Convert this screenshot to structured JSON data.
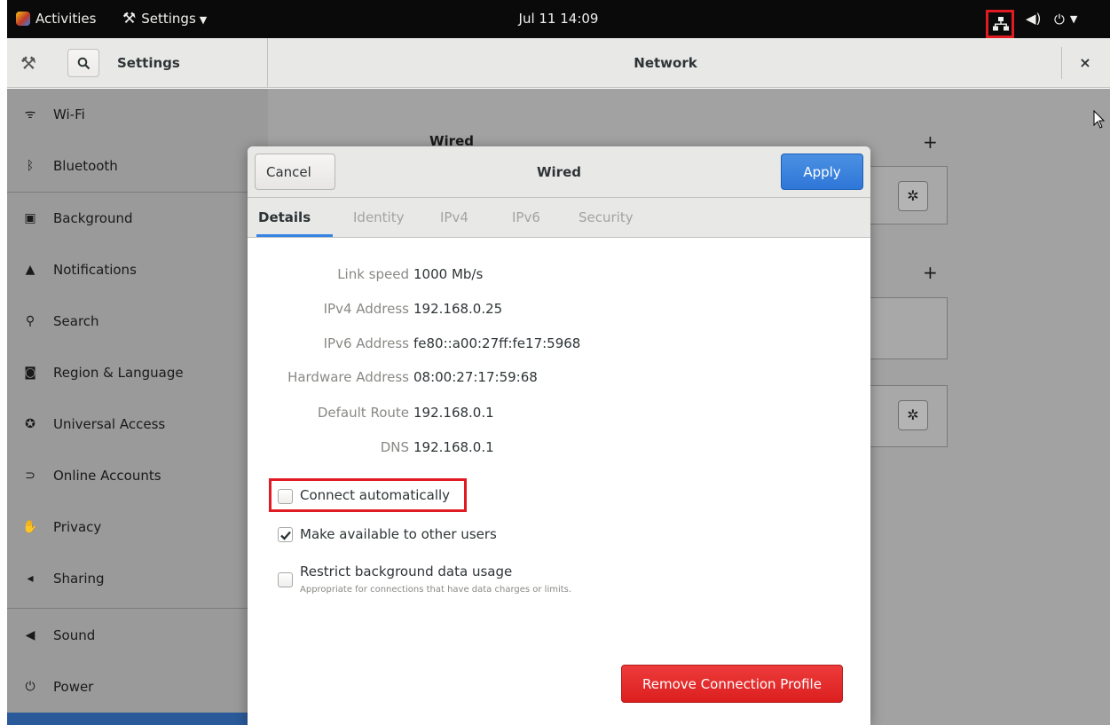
{
  "topbar": {
    "activities": "Activities",
    "app_menu": "Settings",
    "clock": "Jul 11  14:09"
  },
  "header": {
    "sidebar_title": "Settings",
    "title": "Network",
    "close_glyph": "×"
  },
  "sidebar": {
    "items": [
      {
        "label": "Wi-Fi",
        "icon": "wifi-icon"
      },
      {
        "label": "Bluetooth",
        "icon": "bluetooth-icon"
      },
      {
        "label": "Background",
        "icon": "background-icon"
      },
      {
        "label": "Notifications",
        "icon": "bell-icon"
      },
      {
        "label": "Search",
        "icon": "search-icon"
      },
      {
        "label": "Region & Language",
        "icon": "region-icon"
      },
      {
        "label": "Universal Access",
        "icon": "accessibility-icon"
      },
      {
        "label": "Online Accounts",
        "icon": "online-accounts-icon"
      },
      {
        "label": "Privacy",
        "icon": "hand-icon"
      },
      {
        "label": "Sharing",
        "icon": "share-icon"
      },
      {
        "label": "Sound",
        "icon": "speaker-icon"
      },
      {
        "label": "Power",
        "icon": "power-icon"
      }
    ]
  },
  "main": {
    "wired_heading": "Wired",
    "plus": "+"
  },
  "dialog": {
    "cancel": "Cancel",
    "title": "Wired",
    "apply": "Apply",
    "tabs": [
      "Details",
      "Identity",
      "IPv4",
      "IPv6",
      "Security"
    ],
    "details": [
      {
        "label": "Link speed",
        "value": "1000 Mb/s"
      },
      {
        "label": "IPv4 Address",
        "value": "192.168.0.25"
      },
      {
        "label": "IPv6 Address",
        "value": "fe80::a00:27ff:fe17:5968"
      },
      {
        "label": "Hardware Address",
        "value": "08:00:27:17:59:68"
      },
      {
        "label": "Default Route",
        "value": "192.168.0.1"
      },
      {
        "label": "DNS",
        "value": "192.168.0.1"
      }
    ],
    "options": {
      "connect_auto": {
        "label": "Connect automatically",
        "checked": false
      },
      "available_all": {
        "label": "Make available to other users",
        "checked": true
      },
      "restrict_bg": {
        "label": "Restrict background data usage",
        "checked": false,
        "sub": "Appropriate for connections that have data charges or limits."
      }
    },
    "remove": "Remove Connection Profile"
  },
  "colors": {
    "accent": "#3584e4",
    "destructive": "#e01b24",
    "highlight": "#e01b24"
  }
}
